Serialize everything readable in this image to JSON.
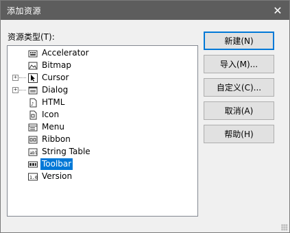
{
  "dialog": {
    "title": "添加资源",
    "close_symbol": "✕",
    "list_label": "资源类型(T):"
  },
  "tree": {
    "items": [
      {
        "label": "Accelerator",
        "icon": "accelerator-icon",
        "expandable": false,
        "selected": false
      },
      {
        "label": "Bitmap",
        "icon": "bitmap-icon",
        "expandable": false,
        "selected": false
      },
      {
        "label": "Cursor",
        "icon": "cursor-icon",
        "expandable": true,
        "selected": false
      },
      {
        "label": "Dialog",
        "icon": "dialog-icon",
        "expandable": true,
        "selected": false
      },
      {
        "label": "HTML",
        "icon": "html-icon",
        "expandable": false,
        "selected": false
      },
      {
        "label": "Icon",
        "icon": "icon-icon",
        "expandable": false,
        "selected": false
      },
      {
        "label": "Menu",
        "icon": "menu-icon",
        "expandable": false,
        "selected": false
      },
      {
        "label": "Ribbon",
        "icon": "ribbon-icon",
        "expandable": false,
        "selected": false
      },
      {
        "label": "String Table",
        "icon": "string-table-icon",
        "expandable": false,
        "selected": false
      },
      {
        "label": "Toolbar",
        "icon": "toolbar-icon",
        "expandable": false,
        "selected": true
      },
      {
        "label": "Version",
        "icon": "version-icon",
        "expandable": false,
        "selected": false
      }
    ],
    "expander_symbol": "+"
  },
  "buttons": {
    "new": "新建(N)",
    "import": "导入(M)...",
    "custom": "自定义(C)...",
    "cancel": "取消(A)",
    "help": "帮助(H)"
  },
  "colors": {
    "titlebar": "#5d5d5d",
    "selection": "#0078d7"
  }
}
